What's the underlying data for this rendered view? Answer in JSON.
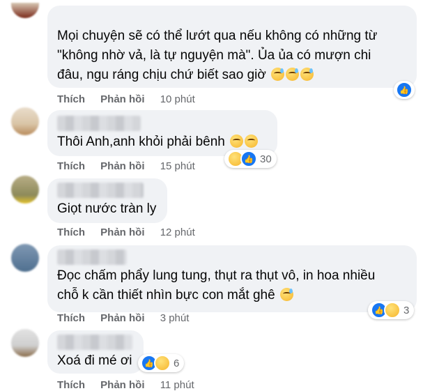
{
  "actions": {
    "like_label": "Thích",
    "reply_label": "Phản hồi"
  },
  "comments": [
    {
      "lines": [
        "Mọi chuyện sẽ có thể lướt qua nếu không có những từ",
        "\"không nhờ vả, là tự nguyện mà\". Ủa ủa có mượn chi",
        "đâu, ngu ráng chịu chứ biết sao giờ"
      ],
      "emojis": [
        "rolling-laughing-emoji",
        "rolling-laughing-emoji",
        "rolling-laughing-emoji"
      ],
      "time": "10 phút",
      "reactions": {
        "icons": [
          "like"
        ],
        "count": ""
      }
    },
    {
      "lines": [
        "Thôi Anh,anh khỏi phải bênh"
      ],
      "emojis": [
        "relieved-emoji",
        "relieved-emoji"
      ],
      "time": "15 phút",
      "reactions": {
        "icons": [
          "haha",
          "like"
        ],
        "count": "30"
      }
    },
    {
      "lines": [
        "Giọt nước tràn ly"
      ],
      "emojis": [],
      "time": "12 phút",
      "reactions": {
        "icons": [],
        "count": ""
      }
    },
    {
      "lines": [
        "Đọc chấm phẩy lung tung, thụt ra thụt vô, in hoa nhiều",
        "chỗ k cần thiết nhìn bực con mắt ghê"
      ],
      "emojis": [
        "sweat-smile-emoji"
      ],
      "time": "3 phút",
      "reactions": {
        "icons": [
          "like",
          "haha"
        ],
        "count": "3"
      }
    },
    {
      "lines": [
        "Xoá đi mé ơi"
      ],
      "emojis": [],
      "time": "11 phút",
      "reactions": {
        "icons": [
          "like",
          "haha"
        ],
        "count": "6"
      }
    }
  ],
  "colors": {
    "bubble": "#f0f2f5",
    "text": "#050505",
    "meta": "#65676b",
    "like_blue": "#1877f2"
  }
}
